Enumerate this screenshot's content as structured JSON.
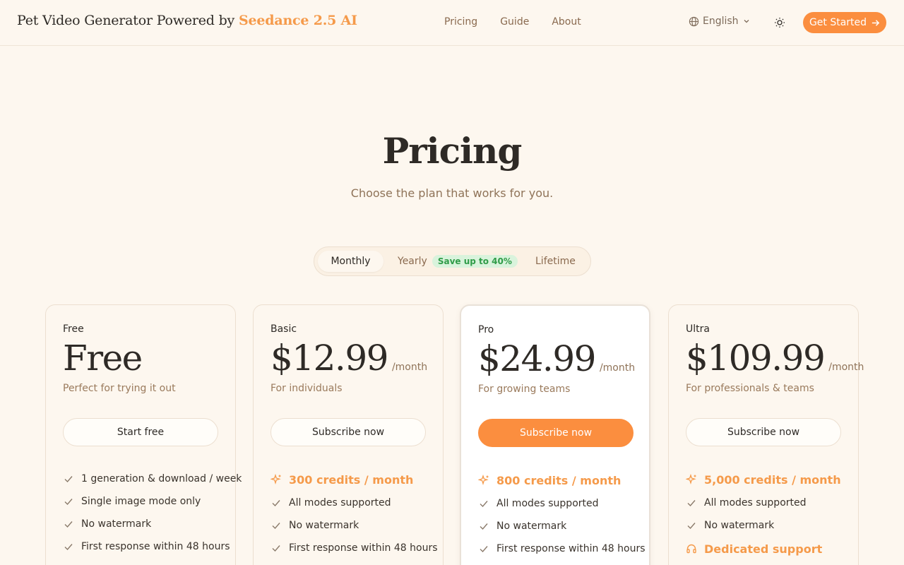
{
  "header": {
    "brand_prefix": "Pet Video Generator Powered by",
    "brand_accent": "Seedance 2.5 AI",
    "nav": [
      "Pricing",
      "Guide",
      "About"
    ],
    "language": "English",
    "cta_label": "Get Started"
  },
  "hero": {
    "title": "Pricing",
    "subtitle": "Choose the plan that works for you."
  },
  "billing_toggle": {
    "monthly": "Monthly",
    "yearly": "Yearly",
    "yearly_badge": "Save up to 40%",
    "lifetime": "Lifetime",
    "selected": "Monthly"
  },
  "plans": [
    {
      "name": "Free",
      "price": "Free",
      "period": "",
      "description": "Perfect for trying it out",
      "button": "Start free",
      "features": [
        {
          "text": "1 generation & download / week",
          "icon": "check-icon"
        },
        {
          "text": "Single image mode only",
          "icon": "check-icon"
        },
        {
          "text": "No watermark",
          "icon": "check-icon"
        },
        {
          "text": "First response within 48 hours",
          "icon": "check-icon"
        }
      ]
    },
    {
      "name": "Basic",
      "price": "$12.99",
      "period": "/month",
      "description": "For individuals",
      "button": "Subscribe now",
      "features": [
        {
          "text": "300 credits / month",
          "icon": "sparkle-icon",
          "accent": true
        },
        {
          "text": "All modes supported",
          "icon": "check-icon"
        },
        {
          "text": "No watermark",
          "icon": "check-icon"
        },
        {
          "text": "First response within 48 hours",
          "icon": "check-icon"
        }
      ]
    },
    {
      "name": "Pro",
      "price": "$24.99",
      "period": "/month",
      "description": "For growing teams",
      "button": "Subscribe now",
      "highlighted": true,
      "features": [
        {
          "text": "800 credits / month",
          "icon": "sparkle-icon",
          "accent": true
        },
        {
          "text": "All modes supported",
          "icon": "check-icon"
        },
        {
          "text": "No watermark",
          "icon": "check-icon"
        },
        {
          "text": "First response within 48 hours",
          "icon": "check-icon"
        }
      ]
    },
    {
      "name": "Ultra",
      "price": "$109.99",
      "period": "/month",
      "description": "For professionals & teams",
      "button": "Subscribe now",
      "features": [
        {
          "text": "5,000 credits / month",
          "icon": "sparkle-icon",
          "accent": true
        },
        {
          "text": "All modes supported",
          "icon": "check-icon"
        },
        {
          "text": "No watermark",
          "icon": "check-icon"
        },
        {
          "text": "Dedicated support",
          "icon": "headset-icon",
          "accent": true
        }
      ]
    }
  ],
  "colors": {
    "accent": "#fb8e3f",
    "background": "#fdf7ef",
    "badge_bg": "#d9f3dc",
    "badge_text": "#2f9c48"
  }
}
